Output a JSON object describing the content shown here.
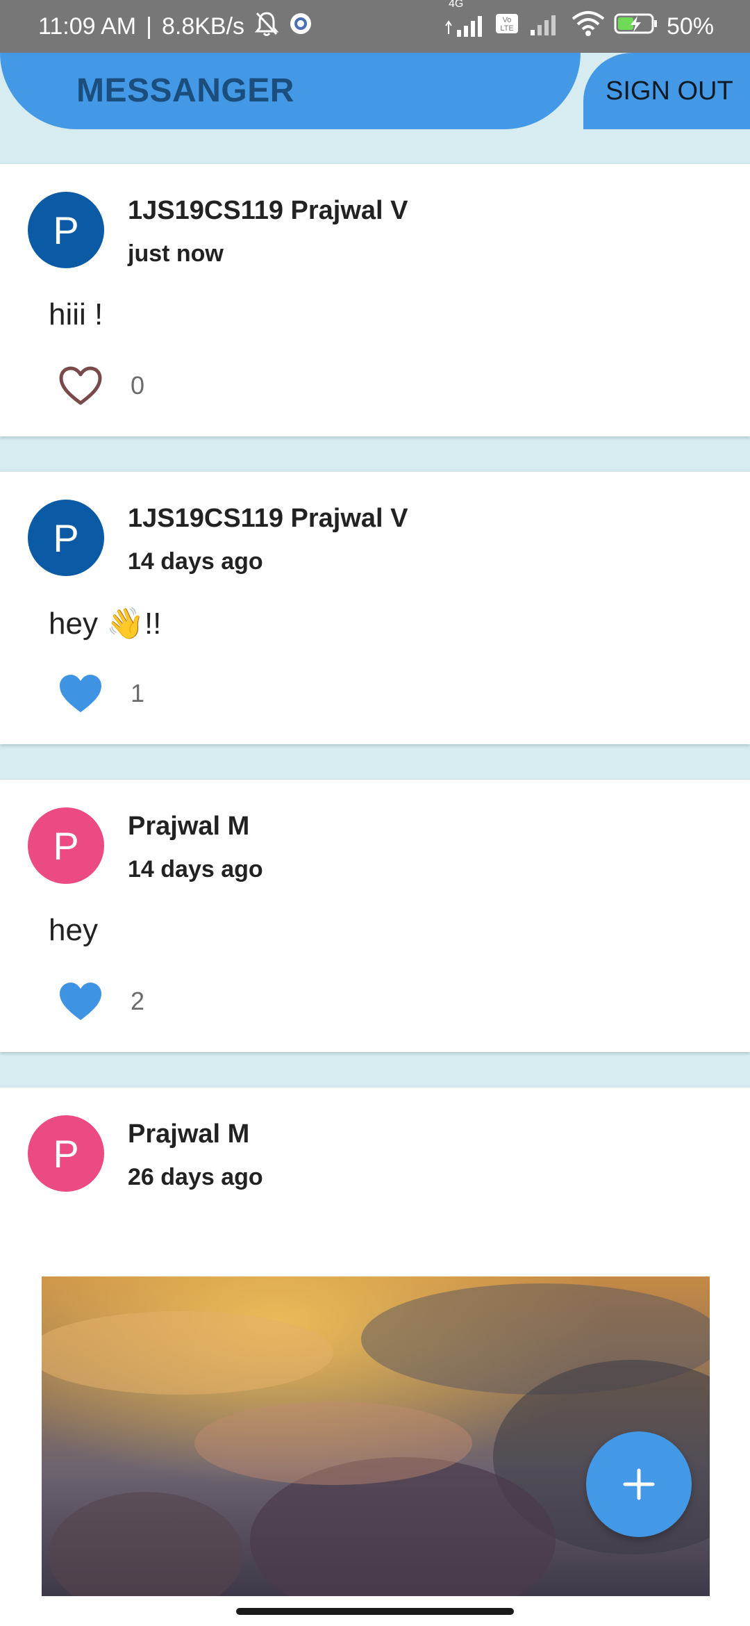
{
  "status_bar": {
    "time": "11:09 AM",
    "separator": "|",
    "speed": "8.8KB/s",
    "network": "4G",
    "volte": "Vo LTE",
    "battery": "50%",
    "icons": [
      "bell-off-icon",
      "gear-badge-icon",
      "signal-icon",
      "volte-icon",
      "signal-icon",
      "wifi-icon",
      "battery-charging-icon"
    ]
  },
  "header": {
    "title": "MESSANGER",
    "sign_out_label": "SIGN OUT",
    "accent_color": "#4399e6",
    "title_color": "#1c4e7d"
  },
  "posts": [
    {
      "avatar_letter": "P",
      "avatar_color": "#0b5aa5",
      "author": "1JS19CS119 Prajwal V",
      "time": "just now",
      "message": "hiii !",
      "liked": false,
      "likes": "0"
    },
    {
      "avatar_letter": "P",
      "avatar_color": "#0b5aa5",
      "author": "1JS19CS119 Prajwal V",
      "time": "14 days ago",
      "message": "hey 👋!!",
      "liked": true,
      "likes": "1"
    },
    {
      "avatar_letter": "P",
      "avatar_color": "#ec4a82",
      "author": "Prajwal M",
      "time": "14 days ago",
      "message": "hey",
      "liked": true,
      "likes": "2"
    },
    {
      "avatar_letter": "P",
      "avatar_color": "#ec4a82",
      "author": "Prajwal M",
      "time": "26 days ago",
      "image": "cloudy-sky-photo"
    }
  ],
  "fab": {
    "icon": "plus-icon"
  }
}
